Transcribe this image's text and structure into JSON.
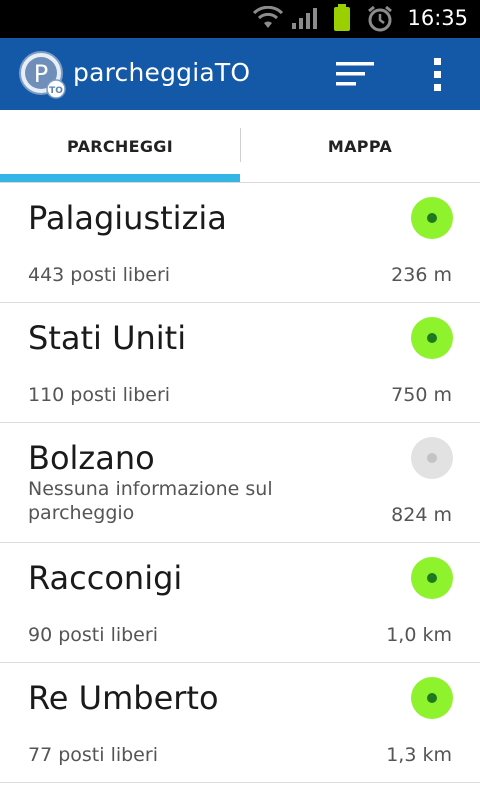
{
  "status_bar": {
    "time": "16:35",
    "icons": [
      "wifi-icon",
      "signal-icon",
      "battery-icon",
      "alarm-icon"
    ]
  },
  "action_bar": {
    "title": "parcheggiaTO",
    "logo_icon": "app-logo-icon",
    "logo_letter": "P",
    "logo_badge": "TO",
    "actions": [
      "sort-icon",
      "overflow-menu-icon"
    ],
    "color": "#1458a8"
  },
  "tabs": [
    {
      "label": "PARCHEGGI",
      "selected": true
    },
    {
      "label": "MAPPA",
      "selected": false
    }
  ],
  "tab_indicator_color": "#33b5e5",
  "parkings": [
    {
      "name": "Palagiustizia",
      "status": "443 posti liberi",
      "distance": "236 m",
      "indicator": "available"
    },
    {
      "name": "Stati Uniti",
      "status": "110 posti liberi",
      "distance": "750 m",
      "indicator": "available"
    },
    {
      "name": "Bolzano",
      "status": "Nessuna informazione sul parcheggio",
      "distance": "824 m",
      "indicator": "unknown"
    },
    {
      "name": "Racconigi",
      "status": "90 posti liberi",
      "distance": "1,0 km",
      "indicator": "available"
    },
    {
      "name": "Re Umberto",
      "status": "77 posti liberi",
      "distance": "1,3 km",
      "indicator": "available"
    }
  ],
  "indicator_colors": {
    "available": "#8ef22c",
    "unknown": "#e2e2e2"
  }
}
